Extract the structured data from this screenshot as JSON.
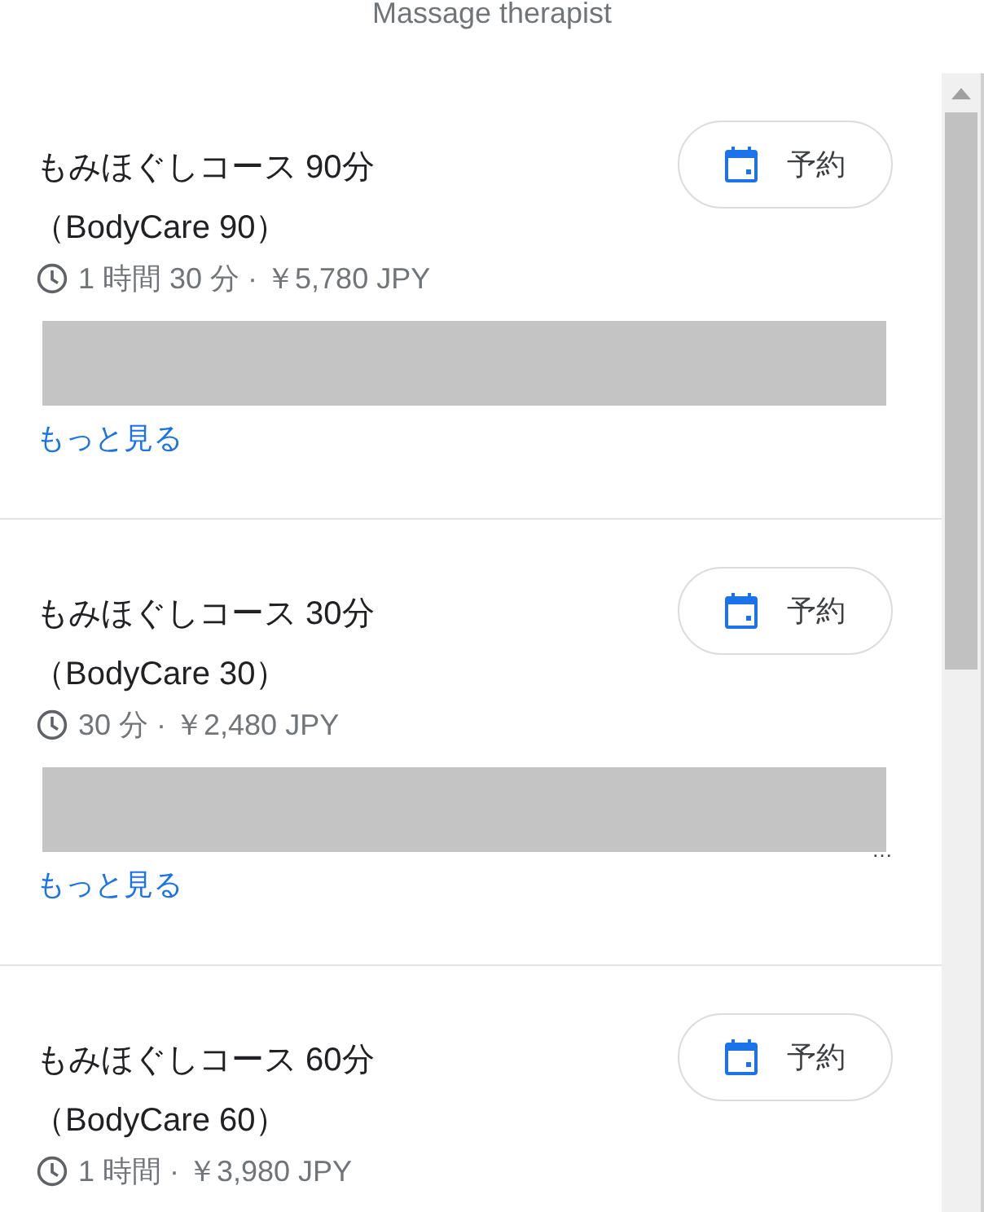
{
  "header": {
    "title": "Massage therapist"
  },
  "services": [
    {
      "title": "もみほぐしコース 90分",
      "subtitle": "（BodyCare 90）",
      "meta": "1 時間 30 分 · ￥5,780 JPY",
      "book_label": "予約",
      "more_link": "もっと見る"
    },
    {
      "title": "もみほぐしコース 30分",
      "subtitle": "（BodyCare 30）",
      "meta": "30 分 · ￥2,480 JPY",
      "book_label": "予約",
      "description_tail": "…",
      "more_link": "もっと見る"
    },
    {
      "title": "もみほぐしコース 60分",
      "subtitle": "（BodyCare 60）",
      "meta": "1 時間 · ￥3,980 JPY",
      "book_label": "予約"
    }
  ]
}
